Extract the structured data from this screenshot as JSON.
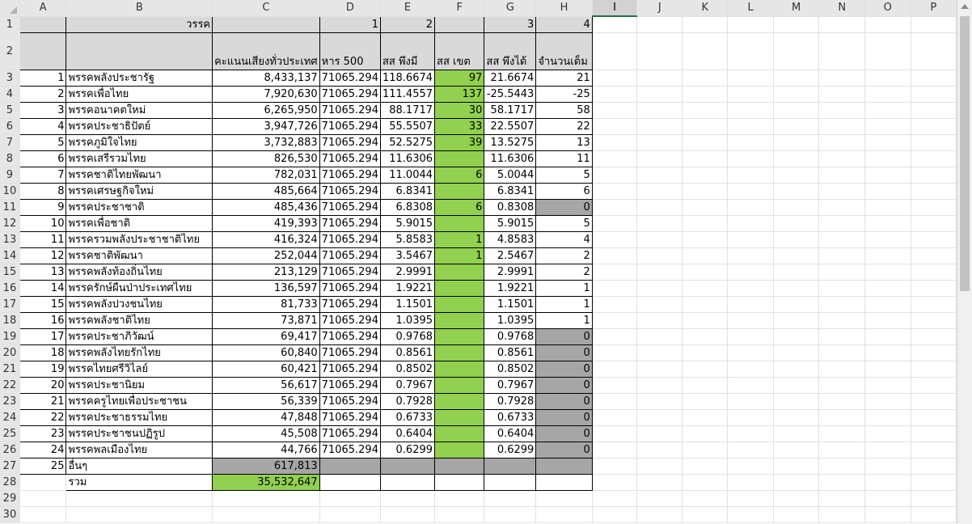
{
  "columns": [
    "A",
    "B",
    "C",
    "D",
    "E",
    "F",
    "G",
    "H",
    "I",
    "J",
    "K",
    "L",
    "M",
    "N",
    "O",
    "P"
  ],
  "selected_column": "I",
  "row1": {
    "B": "วรรค",
    "D": "1",
    "E": "2",
    "G": "3",
    "H": "4"
  },
  "row2": {
    "C": "คะแนนเสียงทั่วประเทศ",
    "D": "หาร 500",
    "E": "สส พึงมี",
    "F": "สส เขต",
    "G": "สส พึงได้",
    "H": "จำนวนเต็ม"
  },
  "parties": [
    {
      "n": "1",
      "name": "พรรคพลังประชารัฐ",
      "votes": "8,433,137",
      "d": "71065.294",
      "e": "118.6674",
      "f": "97",
      "g": "21.6674",
      "h": "21",
      "hgray": false
    },
    {
      "n": "2",
      "name": "พรรคเพื่อไทย",
      "votes": "7,920,630",
      "d": "71065.294",
      "e": "111.4557",
      "f": "137",
      "g": "-25.5443",
      "h": "-25",
      "hgray": false
    },
    {
      "n": "3",
      "name": "พรรคอนาคตใหม่",
      "votes": "6,265,950",
      "d": "71065.294",
      "e": "88.1717",
      "f": "30",
      "g": "58.1717",
      "h": "58",
      "hgray": false
    },
    {
      "n": "4",
      "name": "พรรคประชาธิปัตย์",
      "votes": "3,947,726",
      "d": "71065.294",
      "e": "55.5507",
      "f": "33",
      "g": "22.5507",
      "h": "22",
      "hgray": false
    },
    {
      "n": "5",
      "name": "พรรคภูมิใจไทย",
      "votes": "3,732,883",
      "d": "71065.294",
      "e": "52.5275",
      "f": "39",
      "g": "13.5275",
      "h": "13",
      "hgray": false
    },
    {
      "n": "6",
      "name": "พรรคเสรีรวมไทย",
      "votes": "826,530",
      "d": "71065.294",
      "e": "11.6306",
      "f": "",
      "g": "11.6306",
      "h": "11",
      "hgray": false
    },
    {
      "n": "7",
      "name": "พรรคชาติไทยพัฒนา",
      "votes": "782,031",
      "d": "71065.294",
      "e": "11.0044",
      "f": "6",
      "g": "5.0044",
      "h": "5",
      "hgray": false
    },
    {
      "n": "8",
      "name": "พรรคเศรษฐกิจใหม่",
      "votes": "485,664",
      "d": "71065.294",
      "e": "6.8341",
      "f": "",
      "g": "6.8341",
      "h": "6",
      "hgray": false
    },
    {
      "n": "9",
      "name": "พรรคประชาชาติ",
      "votes": "485,436",
      "d": "71065.294",
      "e": "6.8308",
      "f": "6",
      "g": "0.8308",
      "h": "0",
      "hgray": true
    },
    {
      "n": "10",
      "name": "พรรคเพื่อชาติ",
      "votes": "419,393",
      "d": "71065.294",
      "e": "5.9015",
      "f": "",
      "g": "5.9015",
      "h": "5",
      "hgray": false
    },
    {
      "n": "11",
      "name": "พรรครวมพลังประชาชาติไทย",
      "votes": "416,324",
      "d": "71065.294",
      "e": "5.8583",
      "f": "1",
      "g": "4.8583",
      "h": "4",
      "hgray": false
    },
    {
      "n": "12",
      "name": "พรรคชาติพัฒนา",
      "votes": "252,044",
      "d": "71065.294",
      "e": "3.5467",
      "f": "1",
      "g": "2.5467",
      "h": "2",
      "hgray": false
    },
    {
      "n": "13",
      "name": "พรรคพลังท้องถิ่นไทย",
      "votes": "213,129",
      "d": "71065.294",
      "e": "2.9991",
      "f": "",
      "g": "2.9991",
      "h": "2",
      "hgray": false
    },
    {
      "n": "14",
      "name": "พรรครักษ์ผืนป่าประเทศไทย",
      "votes": "136,597",
      "d": "71065.294",
      "e": "1.9221",
      "f": "",
      "g": "1.9221",
      "h": "1",
      "hgray": false
    },
    {
      "n": "15",
      "name": "พรรคพลังปวงชนไทย",
      "votes": "81,733",
      "d": "71065.294",
      "e": "1.1501",
      "f": "",
      "g": "1.1501",
      "h": "1",
      "hgray": false
    },
    {
      "n": "16",
      "name": "พรรคพลังชาติไทย",
      "votes": "73,871",
      "d": "71065.294",
      "e": "1.0395",
      "f": "",
      "g": "1.0395",
      "h": "1",
      "hgray": false
    },
    {
      "n": "17",
      "name": "พรรคประชาภิวัฒน์",
      "votes": "69,417",
      "d": "71065.294",
      "e": "0.9768",
      "f": "",
      "g": "0.9768",
      "h": "0",
      "hgray": true
    },
    {
      "n": "18",
      "name": "พรรคพลังไทยรักไทย",
      "votes": "60,840",
      "d": "71065.294",
      "e": "0.8561",
      "f": "",
      "g": "0.8561",
      "h": "0",
      "hgray": true
    },
    {
      "n": "19",
      "name": "พรรคไทยศรีวิไลย์",
      "votes": "60,421",
      "d": "71065.294",
      "e": "0.8502",
      "f": "",
      "g": "0.8502",
      "h": "0",
      "hgray": true
    },
    {
      "n": "20",
      "name": "พรรคประชานิยม",
      "votes": "56,617",
      "d": "71065.294",
      "e": "0.7967",
      "f": "",
      "g": "0.7967",
      "h": "0",
      "hgray": true
    },
    {
      "n": "21",
      "name": "พรรคครูไทยเพื่อประชาชน",
      "votes": "56,339",
      "d": "71065.294",
      "e": "0.7928",
      "f": "",
      "g": "0.7928",
      "h": "0",
      "hgray": true
    },
    {
      "n": "22",
      "name": "พรรคประชาธรรมไทย",
      "votes": "47,848",
      "d": "71065.294",
      "e": "0.6733",
      "f": "",
      "g": "0.6733",
      "h": "0",
      "hgray": true
    },
    {
      "n": "23",
      "name": "พรรคประชาชนปฏิรูป",
      "votes": "45,508",
      "d": "71065.294",
      "e": "0.6404",
      "f": "",
      "g": "0.6404",
      "h": "0",
      "hgray": true
    },
    {
      "n": "24",
      "name": "พรรคพลเมืองไทย",
      "votes": "44,766",
      "d": "71065.294",
      "e": "0.6299",
      "f": "",
      "g": "0.6299",
      "h": "0",
      "hgray": true
    }
  ],
  "others_row": {
    "n": "25",
    "name": "อื่นๆ",
    "votes": "617,813"
  },
  "total_row": {
    "name": "รวม",
    "votes": "35,532,647"
  },
  "total_rows": 30,
  "colors": {
    "green": "#92d050",
    "gray": "#a6a6a6",
    "header_fill": "#d9d9d9",
    "selection": "#217346"
  }
}
